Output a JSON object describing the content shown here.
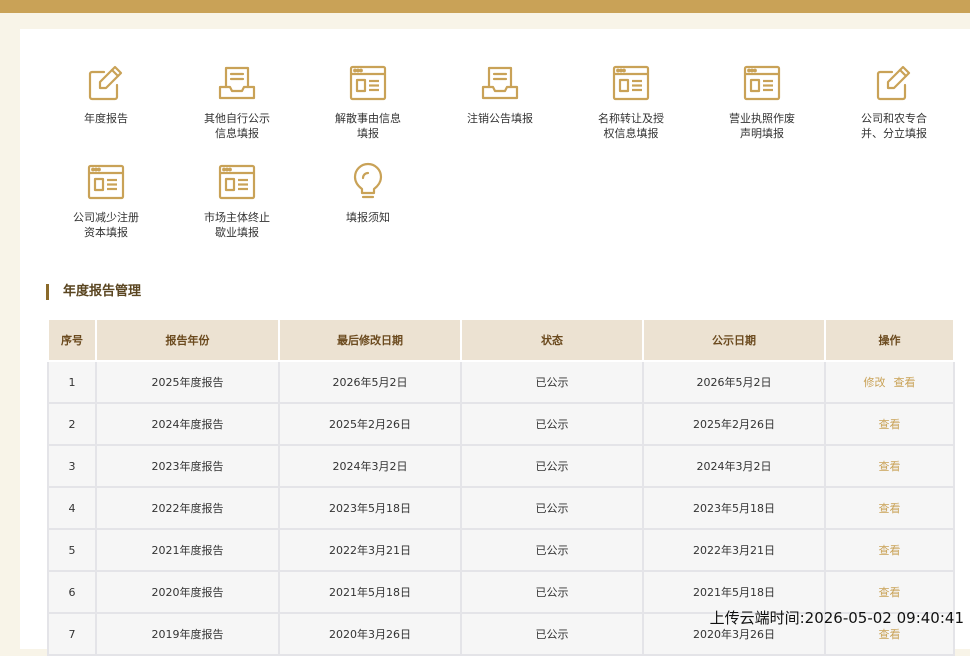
{
  "topbar": {
    "left_text": "",
    "doc_text": "",
    "right_text": ""
  },
  "tiles": [
    {
      "label": "年度报告",
      "icon": "edit-form-icon"
    },
    {
      "label": "其他自行公示\n信息填报",
      "icon": "document-tray-icon"
    },
    {
      "label": "解散事由信息\n填报",
      "icon": "browser-card-icon"
    },
    {
      "label": "注销公告填报",
      "icon": "document-tray-icon"
    },
    {
      "label": "名称转让及授\n权信息填报",
      "icon": "browser-card-icon"
    },
    {
      "label": "营业执照作废\n声明填报",
      "icon": "browser-card-icon"
    },
    {
      "label": "公司和农专合\n并、分立填报",
      "icon": "edit-form-icon"
    },
    {
      "label": "公司减少注册\n资本填报",
      "icon": "browser-card-icon"
    },
    {
      "label": "市场主体终止\n歇业填报",
      "icon": "browser-card-icon"
    },
    {
      "label": "填报须知",
      "icon": "lightbulb-icon"
    }
  ],
  "section": {
    "title": "年度报告管理"
  },
  "table": {
    "headers": [
      "序号",
      "报告年份",
      "最后修改日期",
      "状态",
      "公示日期",
      "操作"
    ],
    "rows": [
      {
        "no": "1",
        "year": "2025年度报告",
        "modified": "2026年5月2日",
        "status": "已公示",
        "published": "2026年5月2日",
        "actions": [
          "修改",
          "查看"
        ]
      },
      {
        "no": "2",
        "year": "2024年度报告",
        "modified": "2025年2月26日",
        "status": "已公示",
        "published": "2025年2月26日",
        "actions": [
          "查看"
        ]
      },
      {
        "no": "3",
        "year": "2023年度报告",
        "modified": "2024年3月2日",
        "status": "已公示",
        "published": "2024年3月2日",
        "actions": [
          "查看"
        ]
      },
      {
        "no": "4",
        "year": "2022年度报告",
        "modified": "2023年5月18日",
        "status": "已公示",
        "published": "2023年5月18日",
        "actions": [
          "查看"
        ]
      },
      {
        "no": "5",
        "year": "2021年度报告",
        "modified": "2022年3月21日",
        "status": "已公示",
        "published": "2022年3月21日",
        "actions": [
          "查看"
        ]
      },
      {
        "no": "6",
        "year": "2020年度报告",
        "modified": "2021年5月18日",
        "status": "已公示",
        "published": "2021年5月18日",
        "actions": [
          "查看"
        ]
      },
      {
        "no": "7",
        "year": "2019年度报告",
        "modified": "2020年3月26日",
        "status": "已公示",
        "published": "2020年3月26日",
        "actions": [
          "查看"
        ]
      }
    ]
  },
  "watermark": {
    "text": "上传云端时间:2026-05-02 09:40:41"
  },
  "colors": {
    "accent": "#c9a257",
    "header_bg": "#ece2d2",
    "page_bg": "#f8f4e8"
  }
}
